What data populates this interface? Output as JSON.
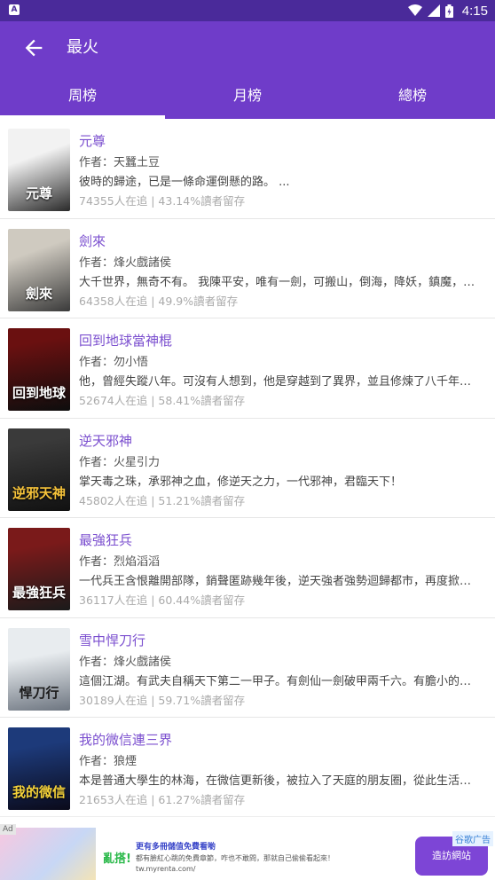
{
  "status_bar": {
    "time": "4:15",
    "notification_letter": "A"
  },
  "header": {
    "title": "最火"
  },
  "tabs": [
    {
      "label": "周榜",
      "active": true
    },
    {
      "label": "月榜",
      "active": false
    },
    {
      "label": "總榜",
      "active": false
    }
  ],
  "books": [
    {
      "title": "元尊",
      "author": "作者：天蠶土豆",
      "desc": "彼時的歸途，已是一條命運倒懸的路。 ...",
      "stats": "74355人在追 | 43.14%讀者留存",
      "cover_text": "元尊",
      "cover_colors": [
        "#f2f2f2",
        "#2a2a2a"
      ]
    },
    {
      "title": "劍來",
      "author": "作者：烽火戲諸侯",
      "desc": "大千世界，無奇不有。 我陳平安，唯有一劍，可搬山，倒海，降妖，鎮魔，敕神，摘星，斷江，摧城，開天！",
      "stats": "64358人在追 | 49.9%讀者留存",
      "cover_text": "劍來",
      "cover_colors": [
        "#cfcac0",
        "#3a3a3a"
      ]
    },
    {
      "title": "回到地球當神棍",
      "author": "作者：勿小悟",
      "desc": "他，曾經失蹤八年。可沒有人想到，他是穿越到了異界，並且修煉了八千年！ ...",
      "stats": "52674人在追 | 58.41%讀者留存",
      "cover_text": "回到地球",
      "cover_colors": [
        "#6a1010",
        "#0d0d0d"
      ]
    },
    {
      "title": "逆天邪神",
      "author": "作者：火星引力",
      "desc": "掌天毒之珠，承邪神之血，修逆天之力，一代邪神，君臨天下！",
      "stats": "45802人在追 | 51.21%讀者留存",
      "cover_text": "逆邪天神",
      "cover_colors": [
        "#2a2a2a",
        "#111111"
      ]
    },
    {
      "title": "最強狂兵",
      "author": "作者：烈焰滔滔",
      "desc": "一代兵王含恨離開部隊，銷聲匿跡幾年後，逆天強者強勢迴歸都市，再度掀起風雲！",
      "stats": "36117人在追 | 60.44%讀者留存",
      "cover_text": "最強狂兵",
      "cover_colors": [
        "#7a1a1a",
        "#1a1a1a"
      ]
    },
    {
      "title": "雪中悍刀行",
      "author": "作者：烽火戲諸侯",
      "desc": "這個江湖。有武夫自稱天下第二一甲子。有劍仙一劍破甲兩千六。有膽小的人 ...",
      "stats": "30189人在追 | 59.71%讀者留存",
      "cover_text": "悍刀行",
      "cover_colors": [
        "#e8ecef",
        "#6d7580"
      ]
    },
    {
      "title": "我的微信連三界",
      "author": "作者：狼煙",
      "desc": "本是普通大學生的林海，在微信更新後，被拉入了天庭的朋友圈，從此生活變得多姿多彩。",
      "stats": "21653人在追 | 61.27%讀者留存",
      "cover_text": "我的微信",
      "cover_colors": [
        "#1d3a7a",
        "#0a0a1a"
      ]
    }
  ],
  "ad": {
    "badge": "Ad",
    "brand": "亂搭!",
    "headline": "更有多冊儲值免費看喲",
    "body": "都有臉紅心跳的免費章節，咋也不敢問，那就自己偷偷看起來！",
    "url": "tw.myrenta.com/",
    "label": "谷歌广告",
    "button": "造訪網站"
  }
}
